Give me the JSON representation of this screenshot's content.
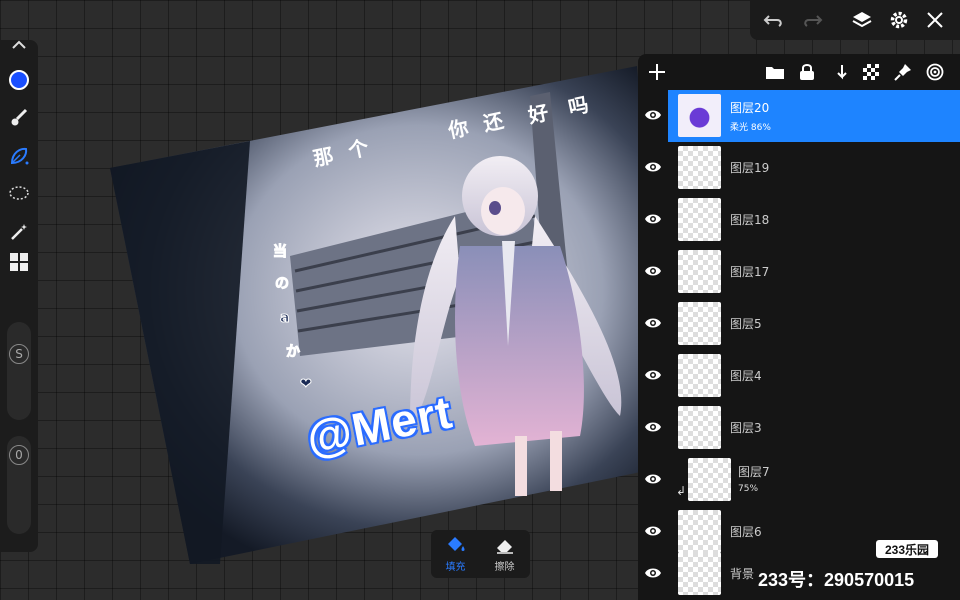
{
  "bottom_tools": [
    {
      "label": "填充",
      "icon": "paint-bucket-icon",
      "active": true
    },
    {
      "label": "擦除",
      "icon": "eraser-icon",
      "active": false
    }
  ],
  "left_tools": [
    {
      "icon": "brush-size-icon"
    },
    {
      "icon": "color-swatch-icon",
      "color": "#1a4fff"
    },
    {
      "icon": "brush-icon"
    },
    {
      "icon": "smudge-icon"
    },
    {
      "icon": "lasso-select-icon"
    },
    {
      "icon": "magic-wand-icon"
    },
    {
      "icon": "grid-icon"
    }
  ],
  "sliders": {
    "size_label": "S",
    "opacity_label": "0"
  },
  "canvas": {
    "overlay_text": "@Mert",
    "vertical_text": "那个你还好吗",
    "side_chars": [
      "当",
      "の",
      "a",
      "か",
      "❤"
    ]
  },
  "layers": [
    {
      "name": "图层20",
      "blend": "柔光",
      "opacity": "86%",
      "selected": true
    },
    {
      "name": "图层19"
    },
    {
      "name": "图层18"
    },
    {
      "name": "图层17"
    },
    {
      "name": "图层5"
    },
    {
      "name": "图层4"
    },
    {
      "name": "图层3"
    },
    {
      "name": "图层7",
      "opacity": "75%",
      "clipped": true
    },
    {
      "name": "图层6"
    },
    {
      "name": "背景"
    }
  ],
  "watermark": {
    "logo": "233乐园",
    "id_text": "233号：290570015"
  },
  "colors": {
    "accent": "#1e84ff",
    "panel": "#151515"
  }
}
